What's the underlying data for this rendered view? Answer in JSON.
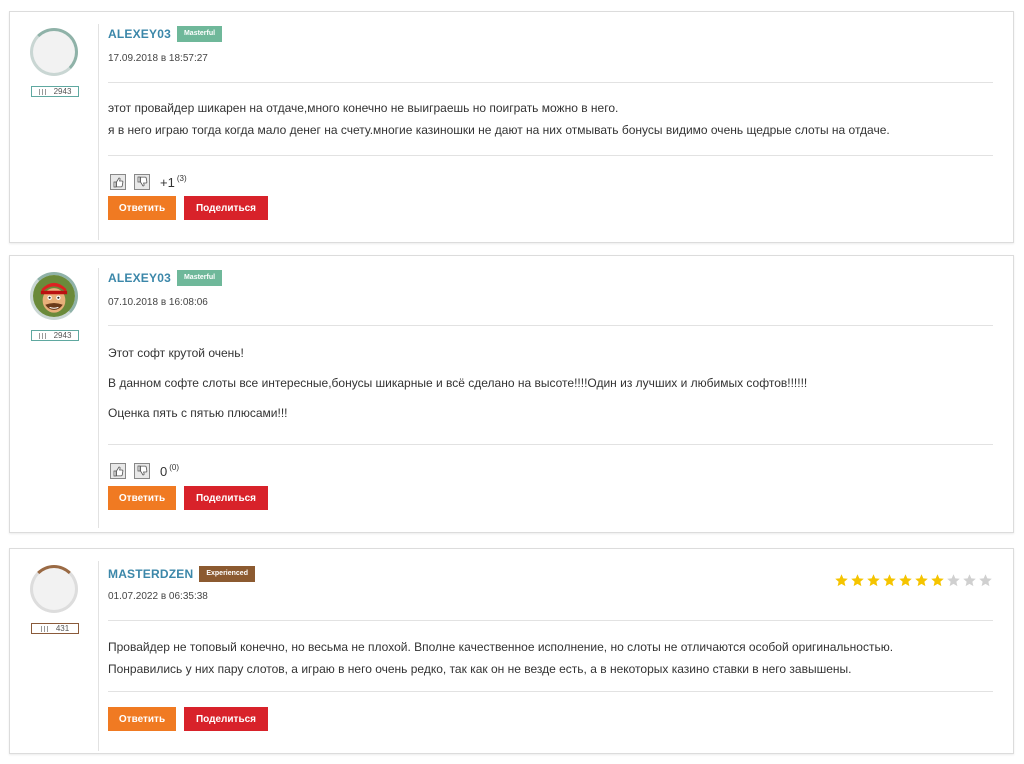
{
  "comments": [
    {
      "username": "ALEXEY03",
      "badge": "Masterful",
      "points": "2943",
      "date": "17.09.2018 в 18:57:27",
      "paragraphs": [
        "этот провайдер шикарен на отдаче,много конечно не выиграешь но поиграть можно в него.",
        "я в него играю тогда когда мало денег на счету.многие казиношки не дают на них отмывать бонусы видимо очень щедрые слоты на отдаче."
      ],
      "score": "+1",
      "vote_count": "(3)",
      "reply_label": "Ответить",
      "share_label": "Поделиться",
      "avatar": "empty-avatar"
    },
    {
      "username": "ALEXEY03",
      "badge": "Masterful",
      "points": "2943",
      "date": "07.10.2018 в 16:08:06",
      "paragraphs": [
        "Этот софт крутой очень!",
        "В данном софте слоты все интересные,бонусы шикарные и всё сделано на высоте!!!!Один из лучших и любимых софтов!!!!!!",
        "Оценка пять с пятью плюсами!!!"
      ],
      "score": "0",
      "vote_count": "(0)",
      "reply_label": "Ответить",
      "share_label": "Поделиться",
      "avatar": "cartoon-character-avatar"
    },
    {
      "username": "MASTERDZEN",
      "badge": "Experienced",
      "points": "431",
      "date": "01.07.2022 в 06:35:38",
      "paragraphs": [
        "Провайдер не топовый конечно, но весьма не плохой. Вполне качественное исполнение, но слоты не отличаются особой оригинальностью.",
        "Понравились у них пару слотов, а играю в него очень редко, так как он не везде есть, а в некоторых казино ставки в него завышены."
      ],
      "rating": 7,
      "rating_max": 10,
      "reply_label": "Ответить",
      "share_label": "Поделиться",
      "avatar": "empty-avatar"
    }
  ],
  "colors": {
    "username": "#3b87a9",
    "masterful_badge": "#6fb89a",
    "experienced_badge": "#8c5a30",
    "reply_button": "#f07a22",
    "share_button": "#d8222a",
    "star_filled": "#f5c400",
    "star_empty": "#d0d0d0"
  },
  "icons": {
    "like": "thumbs-up-icon",
    "dislike": "thumbs-down-icon",
    "rating": "star-icon"
  }
}
